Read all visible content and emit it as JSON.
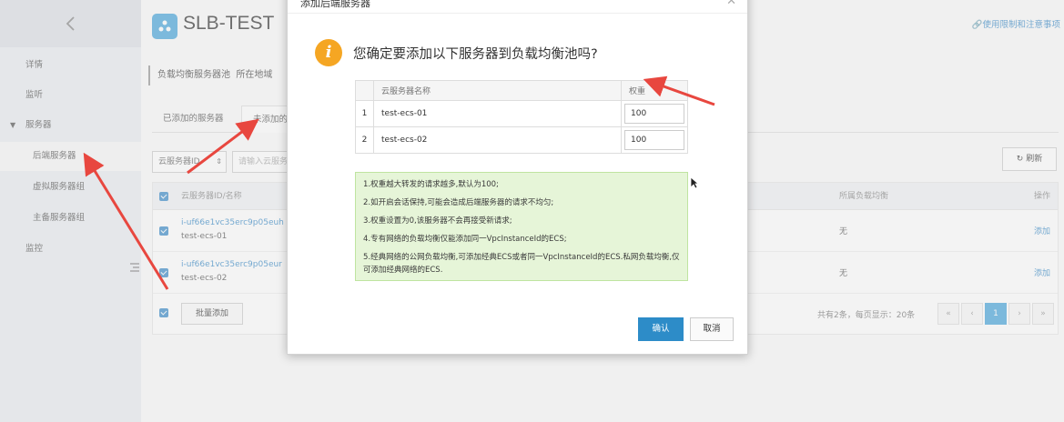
{
  "sidebar": {
    "items": [
      {
        "label": "详情"
      },
      {
        "label": "监听"
      },
      {
        "label": "服务器"
      },
      {
        "label": "后端服务器"
      },
      {
        "label": "虚拟服务器组"
      },
      {
        "label": "主备服务器组"
      },
      {
        "label": "监控"
      }
    ]
  },
  "header": {
    "title": "SLB-TEST",
    "limit_link": "使用限制和注意事项"
  },
  "section": {
    "title": "负载均衡服务器池",
    "region_label": "所在地域"
  },
  "tabs": [
    {
      "label": "已添加的服务器"
    },
    {
      "label": "未添加的"
    }
  ],
  "filter": {
    "select_value": "云服务器ID",
    "input_placeholder": "请输入云服务"
  },
  "refresh_label": "刷新",
  "table": {
    "headers": {
      "id": "云服务器ID/名称",
      "lb": "所属负载均衡",
      "op": "操作"
    },
    "rows": [
      {
        "id": "i-uf66e1vc35erc9p05euh",
        "name": "test-ecs-01",
        "lb": "无",
        "op": "添加"
      },
      {
        "id": "i-uf66e1vc35erc9p05eur",
        "name": "test-ecs-02",
        "lb": "无",
        "op": "添加"
      }
    ],
    "batch_add": "批量添加",
    "pager_info": "共有2条，每页显示：20条",
    "pager": [
      "«",
      "‹",
      "1",
      "›",
      "»"
    ]
  },
  "dialog": {
    "title": "添加后端服务器",
    "question": "您确定要添加以下服务器到负载均衡池吗?",
    "col_name": "云服务器名称",
    "col_weight": "权重",
    "rows": [
      {
        "idx": "1",
        "name": "test-ecs-01",
        "weight": "100"
      },
      {
        "idx": "2",
        "name": "test-ecs-02",
        "weight": "100"
      }
    ],
    "notes": [
      "1.权重越大转发的请求越多,默认为100;",
      "2.如开启会话保持,可能会造成后端服务器的请求不均匀;",
      "3.权重设置为0,该服务器不会再接受新请求;",
      "4.专有网络的负载均衡仅能添加同一VpcInstanceId的ECS;",
      "5.经典网络的公网负载均衡,可添加经典ECS或者同一VpcInstanceId的ECS.私网负载均衡,仅可添加经典网络的ECS."
    ],
    "confirm": "确认",
    "cancel": "取消"
  },
  "colors": {
    "accent": "#2d8cc8",
    "warning": "#f5a623",
    "note_bg": "#e6f5d8",
    "annotation_arrow": "#e8473f"
  }
}
